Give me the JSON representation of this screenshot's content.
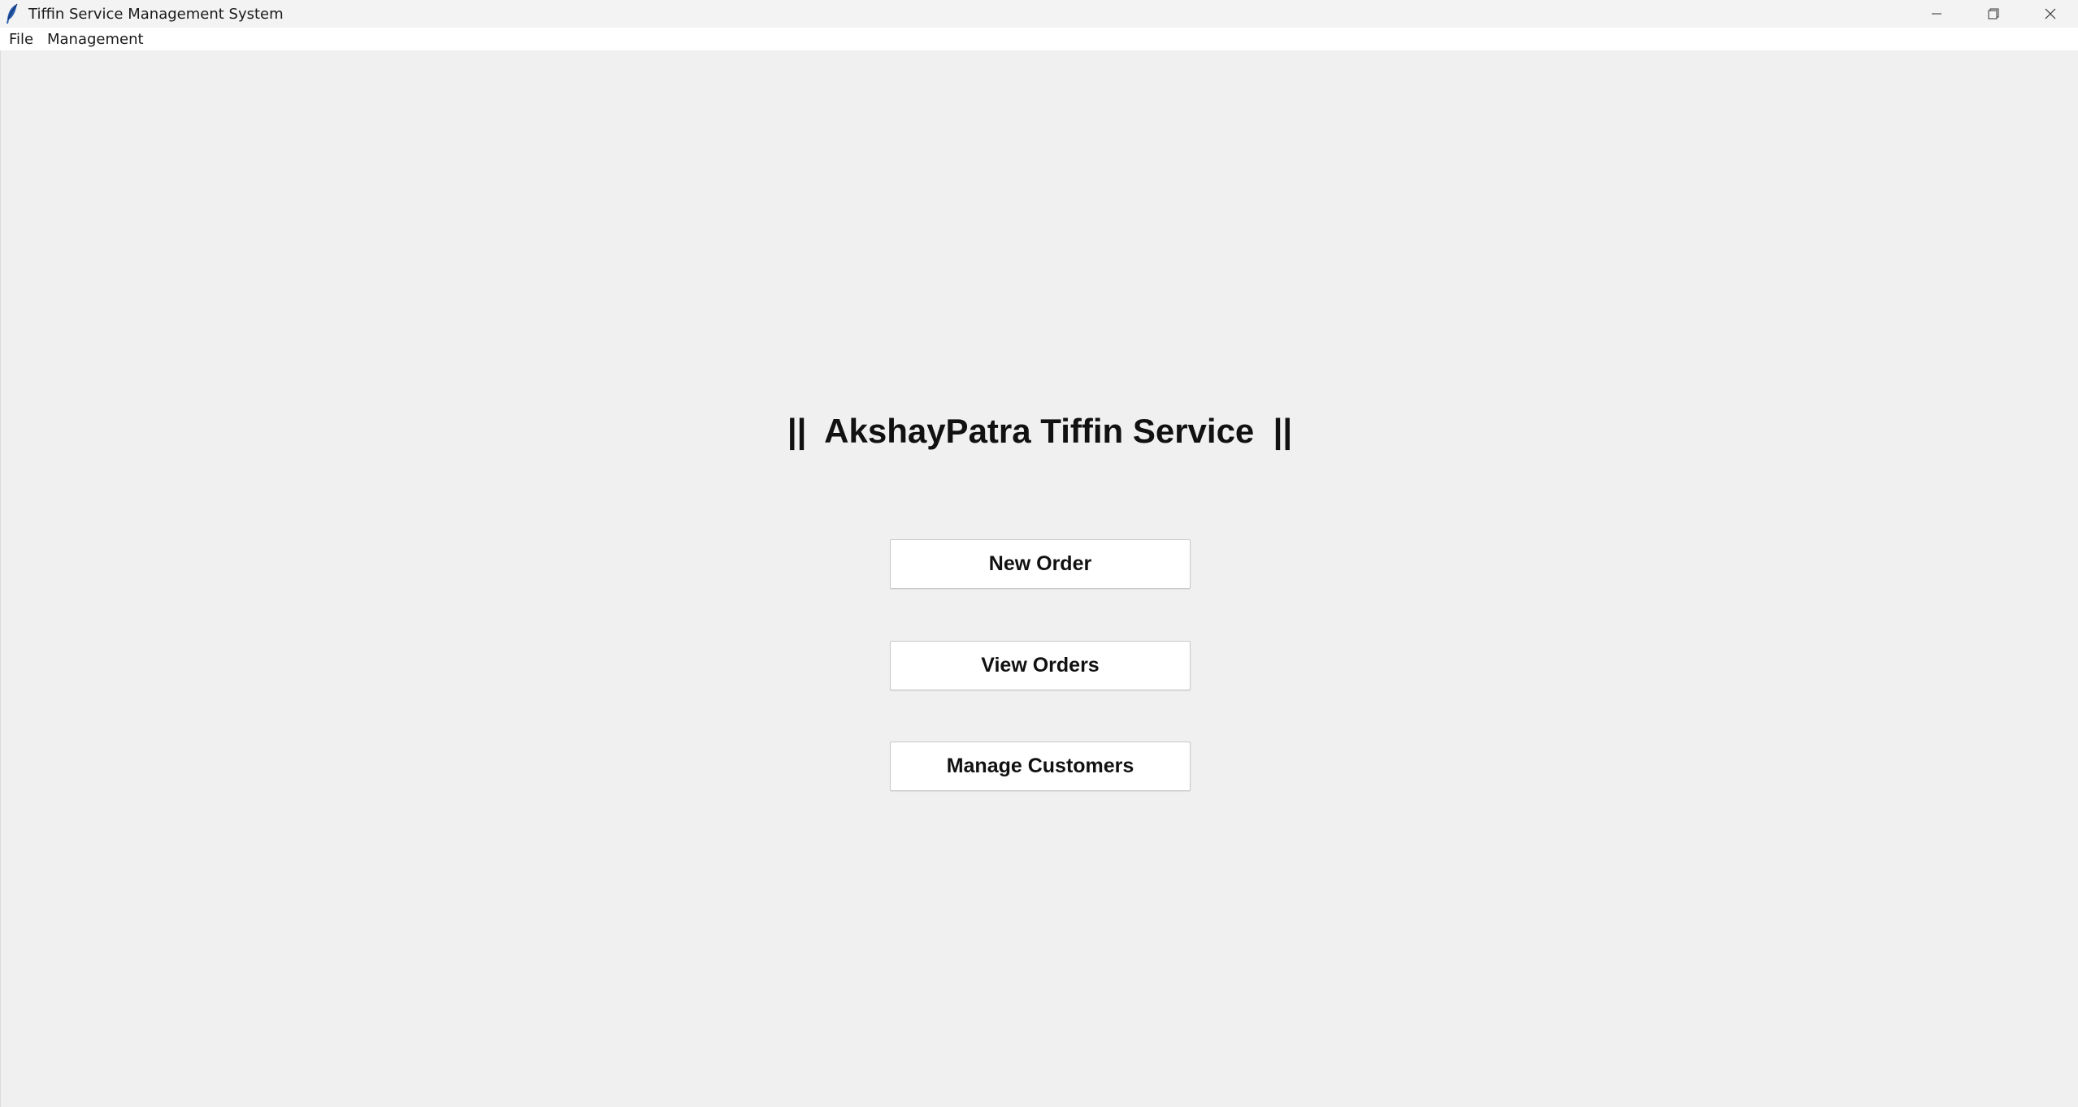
{
  "window": {
    "title": "Tiffin Service Management System",
    "icon": "feather-icon"
  },
  "titlebar_buttons": {
    "minimize_icon": "minimize-icon",
    "maximize_icon": "restore-icon",
    "close_icon": "close-icon"
  },
  "menubar": {
    "items": [
      {
        "label": "File"
      },
      {
        "label": "Management"
      }
    ]
  },
  "main": {
    "heading": "||  AkshayPatra Tiffin Service  ||",
    "buttons": [
      {
        "label": "New Order"
      },
      {
        "label": "View Orders"
      },
      {
        "label": "Manage Customers"
      }
    ]
  },
  "colors": {
    "background": "#f0f0f0",
    "button_background": "#ffffff",
    "text": "#111111"
  }
}
